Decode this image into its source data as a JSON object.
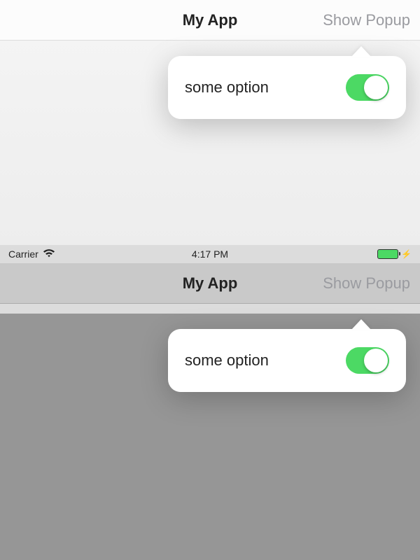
{
  "top": {
    "navbar": {
      "title": "My App",
      "right_button": "Show Popup"
    },
    "popover": {
      "option_label": "some option",
      "toggle_on": true
    }
  },
  "bottom": {
    "statusbar": {
      "carrier": "Carrier",
      "time": "4:17 PM"
    },
    "navbar": {
      "title": "My App",
      "right_button": "Show Popup"
    },
    "popover": {
      "option_label": "some option",
      "toggle_on": true
    }
  },
  "colors": {
    "switch_on": "#4cd964"
  }
}
